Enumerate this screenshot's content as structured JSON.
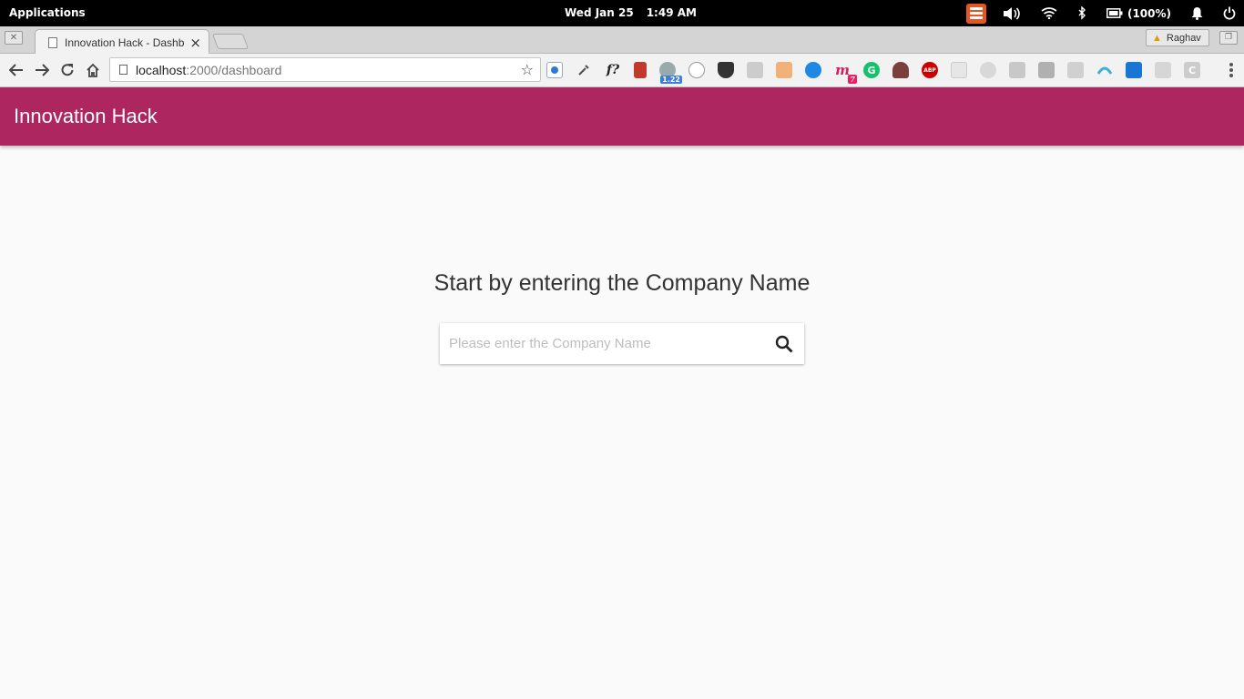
{
  "system_bar": {
    "applications_label": "Applications",
    "date": "Wed Jan 25",
    "time": "1:49 AM",
    "battery_text": "(100%)"
  },
  "browser": {
    "tab_title": "Innovation Hack - Dashb",
    "tab_close": "×",
    "profile_name": "Raghav",
    "url_host": "localhost",
    "url_path": ":2000/dashboard",
    "star_glyph": "☆",
    "extensions": [
      {
        "name": "ext-1",
        "badge": ""
      },
      {
        "name": "ext-eyedropper",
        "badge": ""
      },
      {
        "name": "ext-fontface",
        "label": "f?"
      },
      {
        "name": "ext-red-book",
        "badge": ""
      },
      {
        "name": "ext-speed",
        "badge": "1.22"
      },
      {
        "name": "ext-circle",
        "badge": ""
      },
      {
        "name": "ext-pocket",
        "badge": ""
      },
      {
        "name": "ext-camera",
        "badge": ""
      },
      {
        "name": "ext-face",
        "badge": ""
      },
      {
        "name": "ext-blue-circle",
        "badge": ""
      },
      {
        "name": "ext-m",
        "label": "m",
        "badge": "7"
      },
      {
        "name": "ext-grammarly",
        "label": "G"
      },
      {
        "name": "ext-incognito",
        "badge": ""
      },
      {
        "name": "ext-adblock",
        "label": "ABP"
      },
      {
        "name": "ext-grey-1",
        "badge": ""
      },
      {
        "name": "ext-react",
        "badge": ""
      },
      {
        "name": "ext-grey-2",
        "badge": ""
      },
      {
        "name": "ext-check",
        "badge": ""
      },
      {
        "name": "ext-grey-3",
        "badge": ""
      },
      {
        "name": "ext-rainbow",
        "badge": ""
      },
      {
        "name": "ext-mail",
        "badge": ""
      },
      {
        "name": "ext-grey-4",
        "badge": ""
      },
      {
        "name": "ext-c",
        "label": "C"
      }
    ]
  },
  "app": {
    "title": "Innovation Hack",
    "accent_color": "#ad2660",
    "prompt": "Start by entering the Company Name",
    "search_placeholder": "Please enter the Company Name",
    "search_value": ""
  }
}
